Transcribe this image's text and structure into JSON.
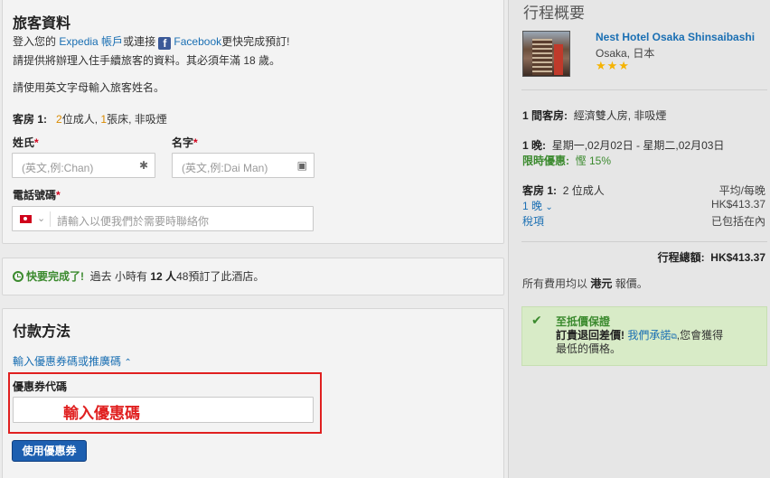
{
  "traveler": {
    "title": "旅客資料",
    "login_prefix": "登入您的",
    "expedia_account": "Expedia 帳戶",
    "or_connect": "或連接",
    "facebook": "Facebook",
    "login_suffix": "更快完成預訂!",
    "info_prefix": "請提供將辦理入住手續旅客的資料。其必須年滿",
    "min_age": "18",
    "age_unit": "歲。",
    "english_note": "請使用英文字母輸入旅客姓名。",
    "room_label": "客房 1:",
    "adults_count": "2",
    "adults_text": "位成人,",
    "beds_count": "1",
    "beds_text": "張床, 非吸煙",
    "surname_label": "姓氏",
    "surname_placeholder": "(英文,例:Chan)",
    "givenname_label": "名字",
    "givenname_placeholder": "(英文,例:Dai Man)",
    "phone_label": "電話號碼",
    "phone_placeholder": "請輸入以便我們於需要時聯絡你",
    "required_mark": "*"
  },
  "urgency": {
    "headline": "快要完成了!",
    "text_prefix": "過去 小時有",
    "count": "12",
    "unit": "人",
    "text_suffix": "48預訂了此酒店。"
  },
  "payment": {
    "title": "付款方法",
    "coupon_toggle": "輸入優惠券碼或推廣碼",
    "coupon_label": "優惠券代碼",
    "coupon_value": "輸入優惠碼",
    "apply_button": "使用優惠券"
  },
  "summary": {
    "title": "行程概要",
    "hotel_name": "Nest Hotel Osaka Shinsaibashi",
    "location": "Osaka, 日本",
    "stars": "★★★",
    "room_line_label": "1 間客房:",
    "room_line_value": "經濟雙人房, 非吸煙",
    "nights_label": "1 晚:",
    "dates": "星期一,02月02日 - 星期二,02月03日",
    "deal_label": "限時優惠:",
    "deal_value": "慳 15%",
    "room1_label": "客房 1:",
    "room1_guests": "2 位成人",
    "avg_label": "平均/每晚",
    "avg_price": "HK$413.37",
    "one_night": "1 晚",
    "night_price": "HK$413.37",
    "taxes": "稅項",
    "taxes_included": "已包括在內",
    "total_label": "行程總額:",
    "total_price": "HK$413.37",
    "currency_prefix": "所有費用均以",
    "currency": "港元",
    "currency_suffix": "報價。",
    "guarantee_title": "至抵價保證",
    "guarantee_bold": "訂貴退回差價!",
    "guarantee_link": "我們承諾",
    "guarantee_rest": ",您會獲得",
    "guarantee_rest2": "最低的價格。"
  },
  "colors": {
    "link": "#1a6fb3",
    "required": "#d0021b",
    "highlight": "#d98a00",
    "green": "#3b8a2e",
    "button": "#1d5fb0",
    "annotation_red": "#e02020"
  }
}
